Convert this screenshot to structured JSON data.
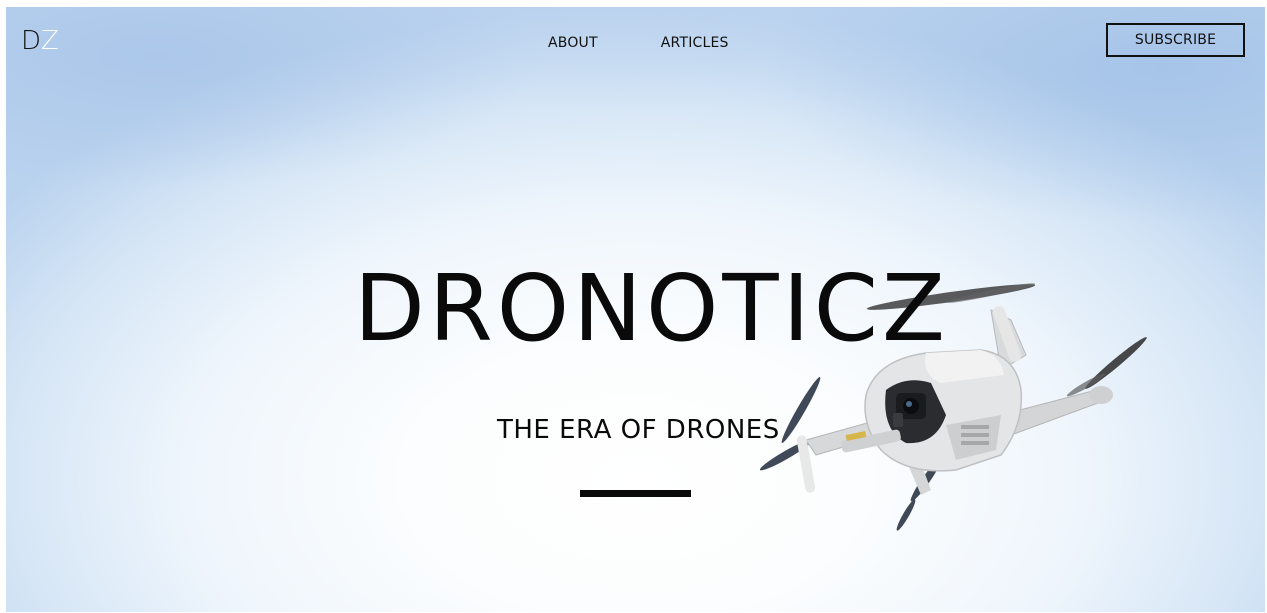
{
  "brand": {
    "logo_first": "D",
    "logo_second": "Z"
  },
  "nav": {
    "items": [
      {
        "label": "ABOUT"
      },
      {
        "label": "ARTICLES"
      }
    ],
    "subscribe_label": "SUBSCRIBE"
  },
  "hero": {
    "title": "DRONOTICZ",
    "subtitle": "THE ERA OF DRONES",
    "image": "drone-photo"
  },
  "colors": {
    "text": "#0a0a0a",
    "logo_accent": "#ffffff",
    "sky_light": "#ffffff",
    "sky_dark": "#b9d2ee"
  }
}
